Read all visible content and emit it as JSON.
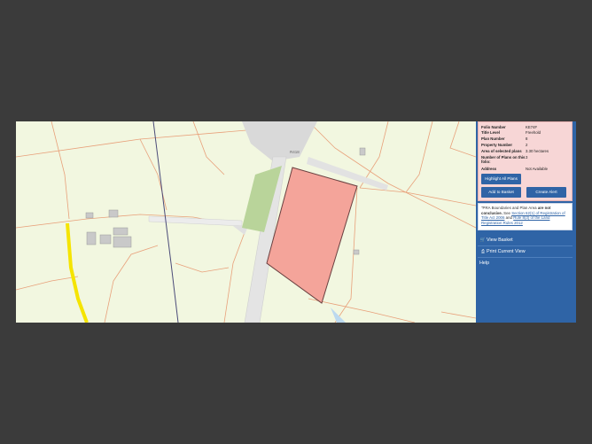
{
  "map": {
    "road_label": "R418",
    "colors": {
      "background": "#f2f7e0",
      "boundary": "#e8a07a",
      "road": "#cfcfcf",
      "plot_fill": "#f4a49a",
      "plot_stroke": "#6a4040",
      "highlight_line": "#f5e400",
      "dark_line": "#4a4a78",
      "green_strip": "#b9d49a"
    }
  },
  "panel": {
    "info": {
      "folio_number_label": "Folio Number",
      "folio_number_value": "KE74F",
      "title_level_label": "Title Level",
      "title_level_value": "Freehold",
      "plan_number_label": "Plan Number",
      "plan_number_value": "8",
      "property_number_label": "Property Number",
      "property_number_value": "2",
      "area_label": "Area of selected plans",
      "area_value": "3.30 hectares",
      "num_plans_label": "Number of Plans on this folio:",
      "num_plans_value": "3",
      "address_label": "Address",
      "address_value": "Not Available"
    },
    "buttons": {
      "highlight_all": "Highlight All Plans",
      "add_to_basket": "Add to Basket",
      "create_alert": "Create Alert"
    },
    "notice": {
      "prefix": "\"PRA Boundaries and Plan Area ",
      "bold": "are not conclusive.",
      "middle": " See ",
      "link1": "Section 62(1) of Registration of Title Act 2006",
      "and": " and ",
      "link2": "Rule 8(3) of the Land Registration Rules 2012"
    },
    "menu": {
      "view_basket": "View Basket",
      "print_current_view": "Print Current View",
      "help": "Help"
    }
  }
}
